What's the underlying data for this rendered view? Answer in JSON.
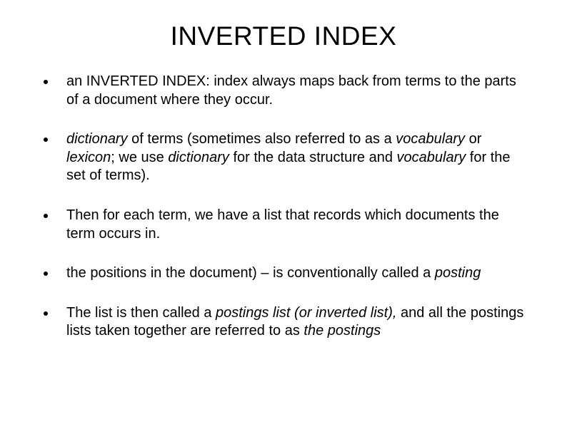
{
  "title": "INVERTED INDEX",
  "bullets": [
    {
      "t1": "an INVERTED INDEX: index always maps back from terms to the parts of a document where they occur."
    },
    {
      "t1": "dictionary",
      "t2": " of terms (sometimes also referred to as a ",
      "t3": "vocabulary",
      "t4": " or ",
      "t5": "lexicon",
      "t6": "; we use ",
      "t7": "dictionary",
      "t8": " for the data structure and ",
      "t9": "vocabulary",
      "t10": " for the set of terms)."
    },
    {
      "t1": "Then for each term, we have a list that records which documents the term occurs in."
    },
    {
      "t1": "the positions in the document) – is conventionally called a ",
      "t2": "posting"
    },
    {
      "t1": "The list is then called a ",
      "t2": "postings list (or inverted list),",
      "t3": " and all the postings lists taken together are referred to as  ",
      "t4": "the postings"
    }
  ]
}
